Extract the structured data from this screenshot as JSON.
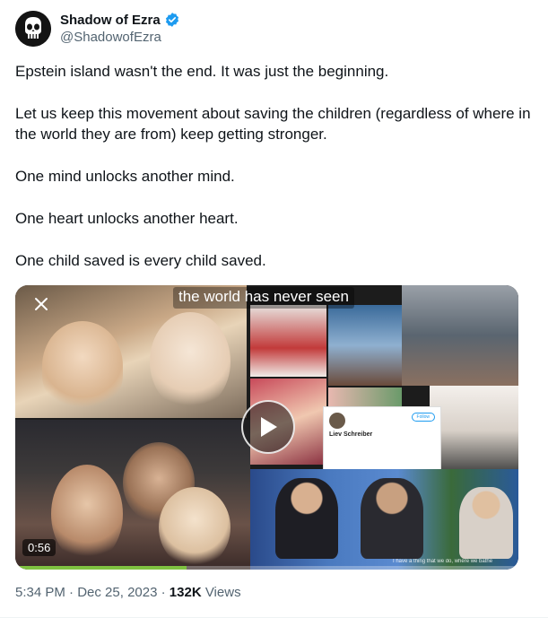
{
  "author": {
    "name": "Shadow of Ezra",
    "handle": "@ShadowofEzra",
    "verified": true,
    "avatar_icon": "punisher-skull-icon"
  },
  "tweet": {
    "paragraphs": [
      "Epstein island wasn't the end. It was just the beginning.",
      "Let us keep this movement about saving the children (regardless of where in the world they are from) keep getting stronger.",
      "One mind unlocks another mind.",
      "One heart unlocks another heart.",
      "One child saved is every child saved."
    ]
  },
  "media": {
    "type": "video",
    "caption": "the world has never seen",
    "duration": "0:56",
    "progress": 0.34,
    "close_icon": "close-icon",
    "play_icon": "play-icon",
    "inset_profile": {
      "name": "Liev Schreiber",
      "button": "Follow"
    },
    "subtitle": "I have a thing that we do, where we bathe"
  },
  "meta": {
    "time": "5:34 PM",
    "separator": "·",
    "date": "Dec 25, 2023",
    "views_count": "132K",
    "views_label": "Views"
  },
  "colors": {
    "verified_badge": "#1d9bf0",
    "progress_fill": "#7fc241",
    "text_primary": "#0f1419",
    "text_secondary": "#536471"
  }
}
